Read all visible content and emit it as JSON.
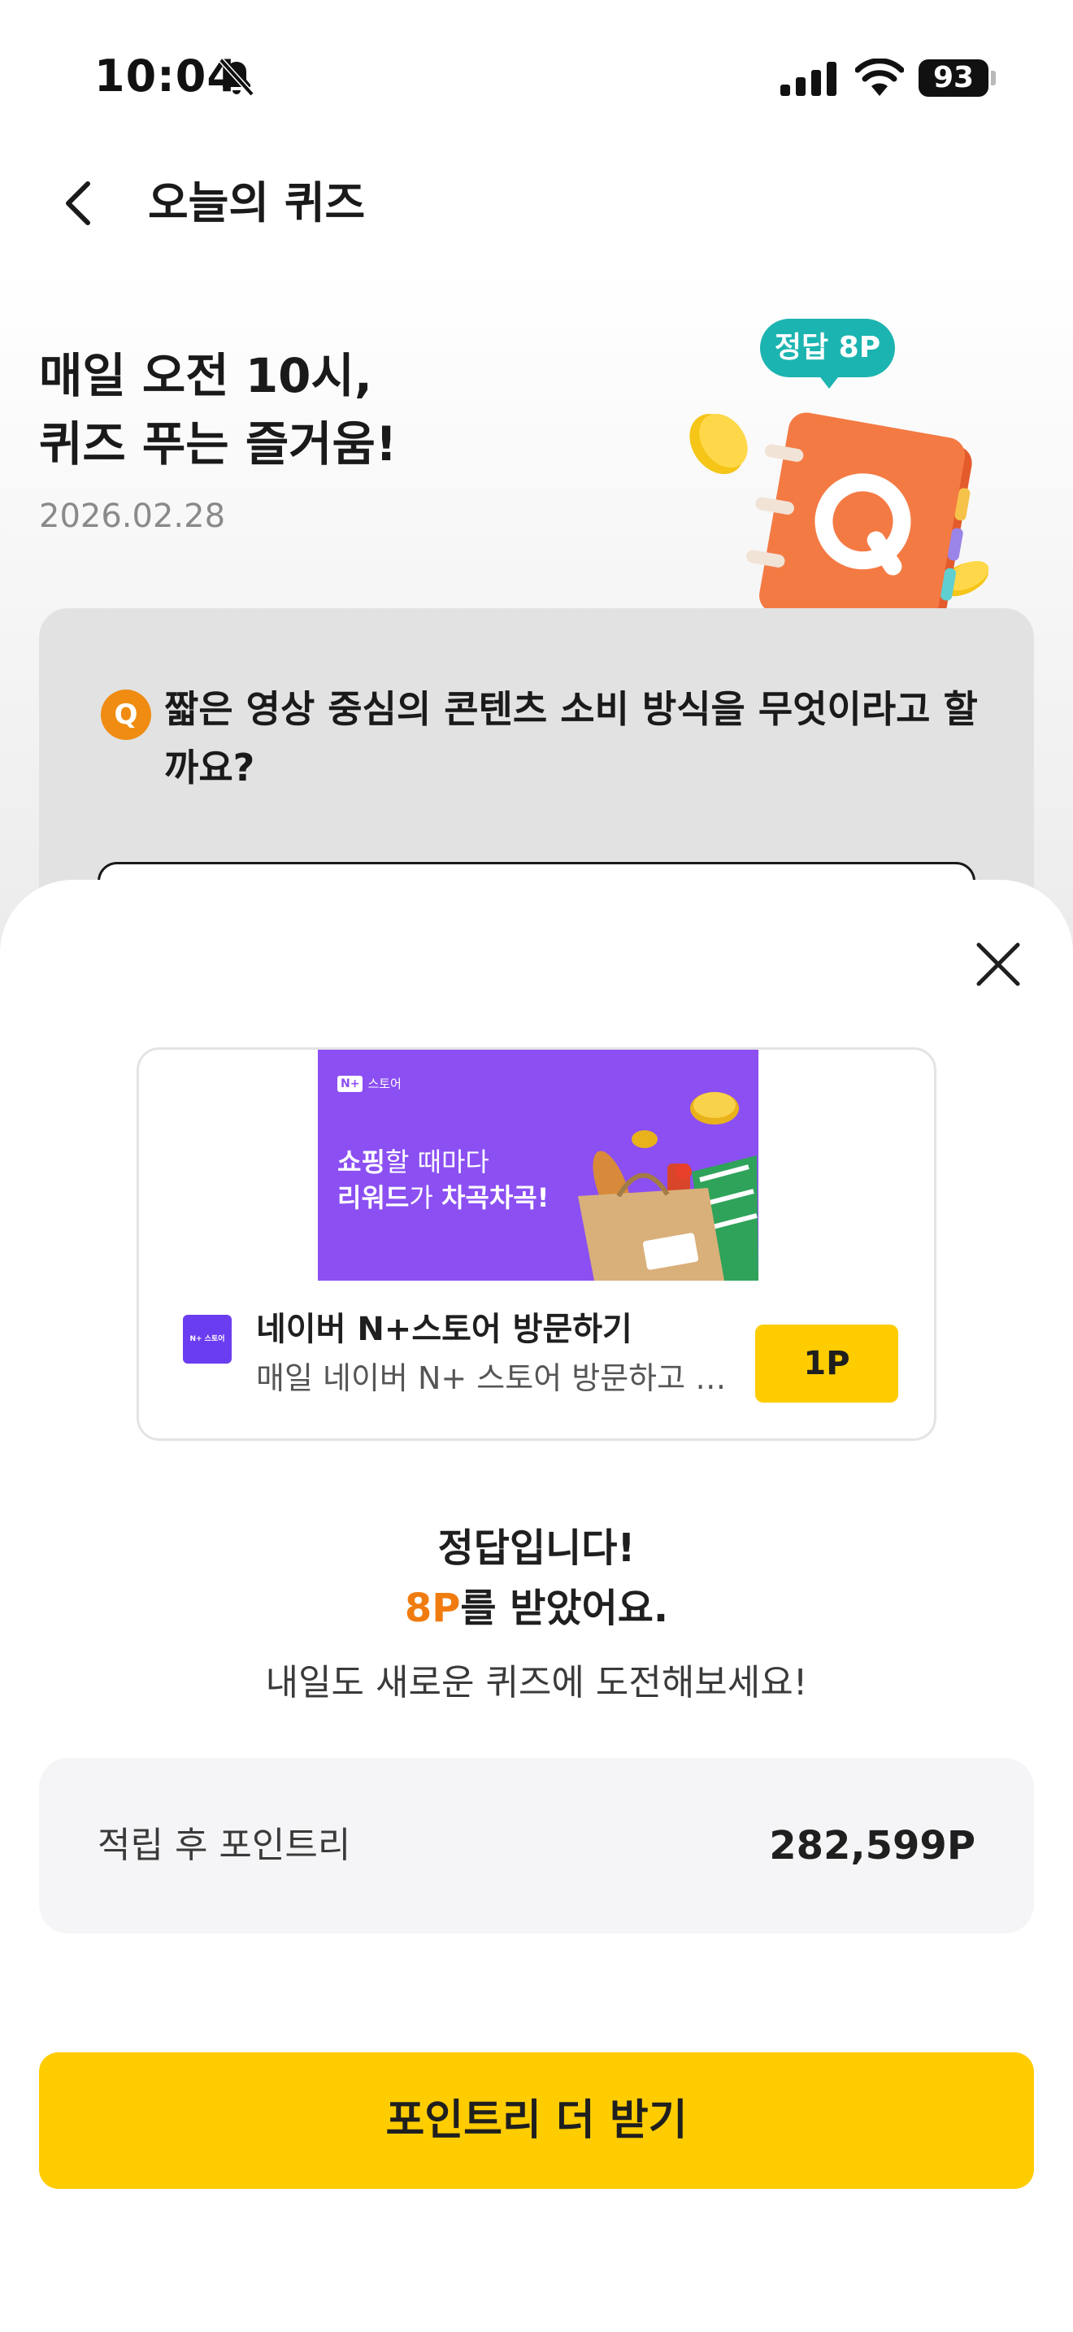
{
  "status_bar": {
    "time": "10:04",
    "battery": "93"
  },
  "nav": {
    "title": "오늘의 퀴즈"
  },
  "quiz": {
    "headline_line1": "매일 오전 10시,",
    "headline_line2": "퀴즈 푸는 즐거움!",
    "date": "2026.02.28",
    "reward_bubble": "정답 8P",
    "badge": "Q",
    "question": "짧은 영상 중심의 콘텐츠 소비 방식을 무엇이라고 할까요?"
  },
  "sheet": {
    "ad": {
      "banner_brand_chip": "N+",
      "banner_brand_label": "스토어",
      "banner_copy_line1_bold": "쇼핑",
      "banner_copy_line1_rest": "할 때마다",
      "banner_copy_line2_bold": "리워드",
      "banner_copy_line2_rest": "가 ",
      "banner_copy_line2_bold2": "차곡차곡!",
      "logo_text": "N+ 스토어",
      "title": "네이버 N+스토어 방문하기",
      "description": "매일 네이버 N+ 스토어 방문하고 포인트 받기",
      "point_label": "1P"
    },
    "result": {
      "title": "정답입니다!",
      "points_highlight": "8P",
      "points_suffix": "를 받았어요.",
      "subtitle": "내일도 새로운 퀴즈에 도전해보세요!"
    },
    "balance": {
      "label": "적립 후 포인트리",
      "value": "282,599P"
    },
    "cta_label": "포인트리 더 받기"
  },
  "colors": {
    "accent_yellow": "#ffcc00",
    "accent_orange": "#f07c10",
    "teal_bubble": "#1cb4b0",
    "ad_purple": "#8b4ff2"
  }
}
